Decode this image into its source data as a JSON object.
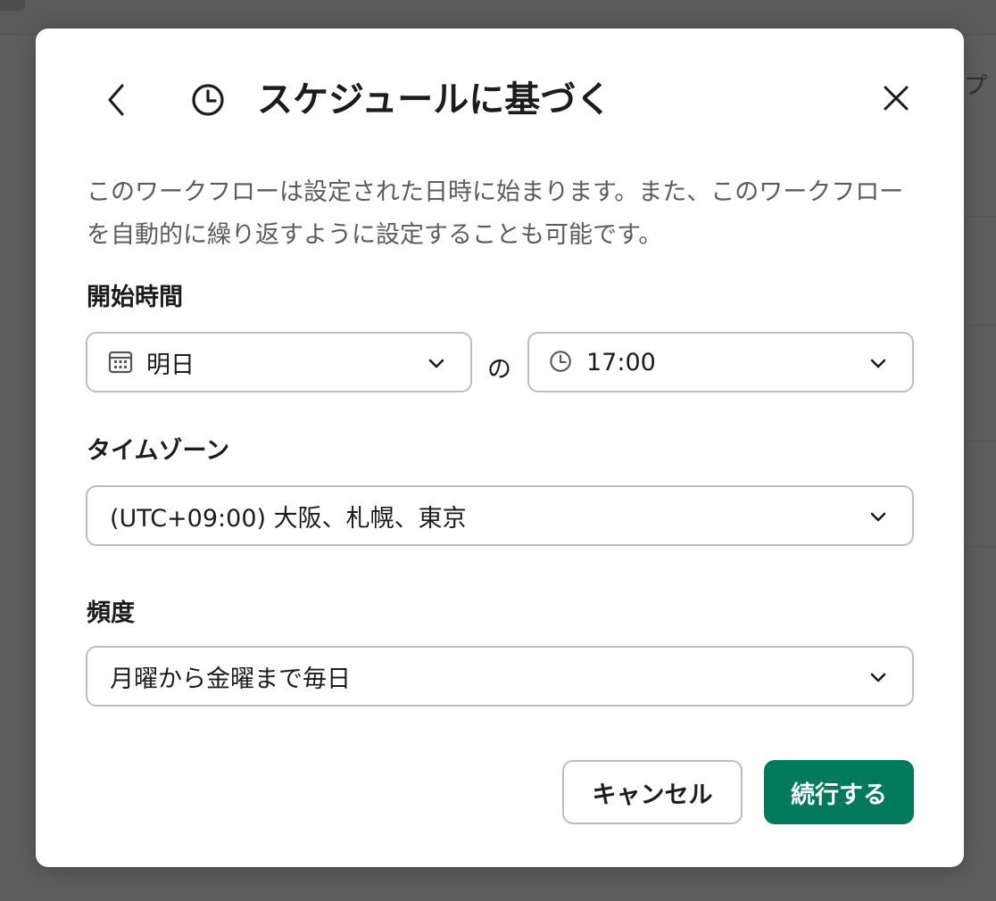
{
  "background": {
    "side_text": "プ"
  },
  "modal": {
    "title": "スケジュールに基づく",
    "description": "このワークフローは設定された日時に始まります。また、このワークフローを自動的に繰り返すように設定することも可能です。",
    "start_time": {
      "label": "開始時間",
      "date_value": "明日",
      "connector": "の",
      "time_value": "17:00"
    },
    "timezone": {
      "label": "タイムゾーン",
      "value": "(UTC+09:00) 大阪、札幌、東京"
    },
    "frequency": {
      "label": "頻度",
      "value": "月曜から金曜まで毎日"
    },
    "buttons": {
      "cancel": "キャンセル",
      "continue": "続行する"
    },
    "colors": {
      "primary": "#007a5a",
      "overlay": "#5e5e5e"
    }
  }
}
